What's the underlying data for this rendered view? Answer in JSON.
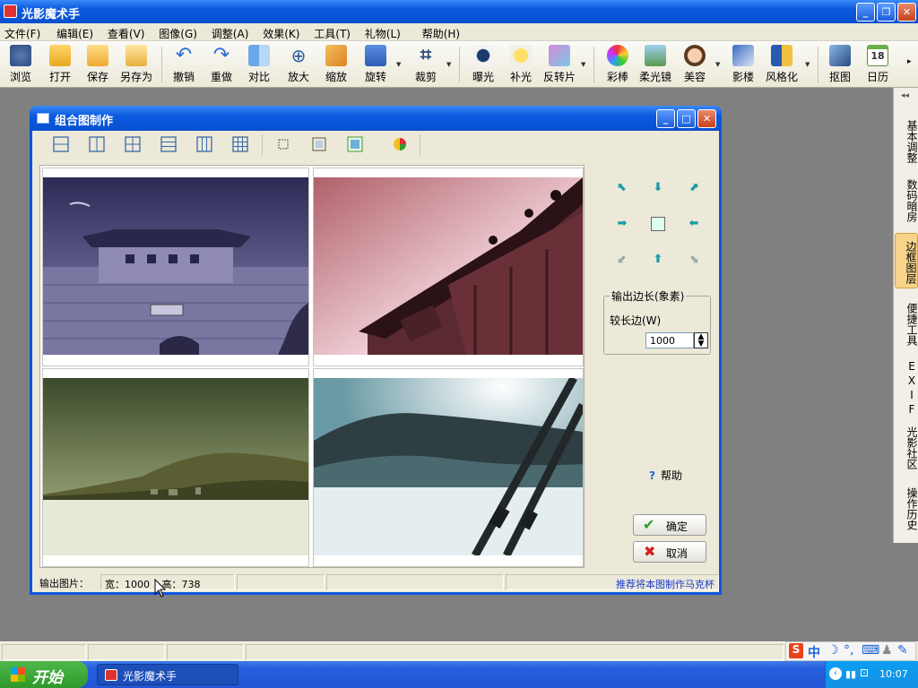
{
  "app": {
    "title": "光影魔术手",
    "menu": [
      "文件(F)",
      "编辑(E)",
      "查看(V)",
      "图像(G)",
      "调整(A)",
      "效果(K)",
      "工具(T)",
      "礼物(L)",
      "帮助(H)"
    ],
    "toolbar": [
      "浏览",
      "打开",
      "保存",
      "另存为",
      "撤销",
      "重做",
      "对比",
      "放大",
      "缩放",
      "旋转",
      "裁剪",
      "曝光",
      "补光",
      "反转片",
      "彩棒",
      "柔光镜",
      "美容",
      "影楼",
      "风格化",
      "抠图",
      "日历"
    ],
    "calendar_day": "18",
    "right_tabs": [
      "基本调整",
      "数码暗房",
      "边框图层",
      "便捷工具",
      "EXIF",
      "光影社区",
      "操作历史"
    ],
    "active_right_tab": "边框图层"
  },
  "dialog": {
    "title": "组合图制作",
    "output_group_title": "输出边长(象素)",
    "long_side_label": "较长边(W)",
    "long_side_value": "1000",
    "help_label": "帮助",
    "ok_label": "确定",
    "cancel_label": "取消",
    "status": {
      "output_label": "输出图片：",
      "width_text": "宽：1000",
      "height_text": "高：738",
      "link_text": "推荐将本图制作马克杯"
    }
  },
  "taskbar": {
    "start_label": "开始",
    "task_item": "光影魔术手",
    "clock": "10:07"
  },
  "ime": {
    "mode": "中"
  }
}
